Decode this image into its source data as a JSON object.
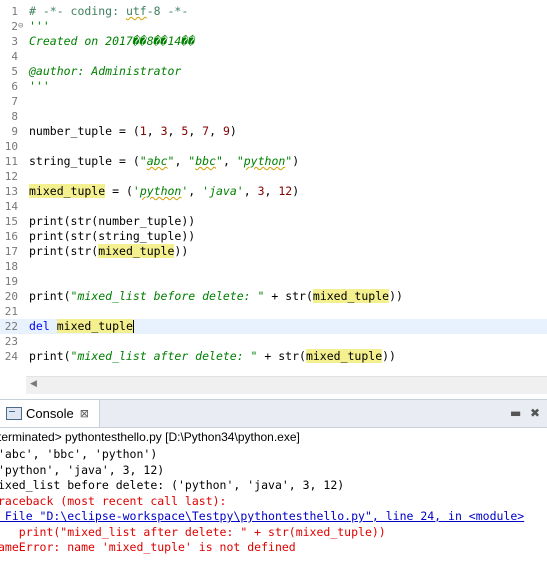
{
  "editor": {
    "current_line": 22,
    "lines": [
      {
        "n": 1,
        "fold": "",
        "html": "<span class=\"c-comment\"># -*- coding: <span class=\"sq\">utf</span>-8 -*-</span>"
      },
      {
        "n": 2,
        "fold": "⊖",
        "html": "<span class=\"c-doc\">'''</span>"
      },
      {
        "n": 3,
        "fold": "",
        "html": "<span class=\"c-doc\">Created on 2017��8��14��</span>"
      },
      {
        "n": 4,
        "fold": "",
        "html": ""
      },
      {
        "n": 5,
        "fold": "",
        "html": "<span class=\"c-doc\">@author: Administrator</span>"
      },
      {
        "n": 6,
        "fold": "",
        "html": "<span class=\"c-doc\">'''</span>"
      },
      {
        "n": 7,
        "fold": "",
        "html": ""
      },
      {
        "n": 8,
        "fold": "",
        "html": ""
      },
      {
        "n": 9,
        "fold": "",
        "html": "number_tuple = (<span class=\"c-num\">1</span>, <span class=\"c-num\">3</span>, <span class=\"c-num\">5</span>, <span class=\"c-num\">7</span>, <span class=\"c-num\">9</span>)"
      },
      {
        "n": 10,
        "fold": "",
        "html": ""
      },
      {
        "n": 11,
        "fold": "",
        "html": "string_tuple = (<span class=\"c-str\">\"<span class=\"sq\">abc</span>\"</span>, <span class=\"c-str\">\"<span class=\"sq\">bbc</span>\"</span>, <span class=\"c-str\">\"<span class=\"sq\">python</span>\"</span>)"
      },
      {
        "n": 12,
        "fold": "",
        "html": ""
      },
      {
        "n": 13,
        "fold": "",
        "html": "<span class=\"hl\">mixed_tuple</span> = (<span class=\"c-str\">'<span class=\"sq\">python</span>'</span>, <span class=\"c-str\">'java'</span>, <span class=\"c-num\">3</span>, <span class=\"c-num\">12</span>)"
      },
      {
        "n": 14,
        "fold": "",
        "html": ""
      },
      {
        "n": 15,
        "fold": "",
        "html": "print(str(number_tuple))"
      },
      {
        "n": 16,
        "fold": "",
        "html": "print(str(string_tuple))"
      },
      {
        "n": 17,
        "fold": "",
        "html": "print(str(<span class=\"hl\">mixed_tuple</span>))"
      },
      {
        "n": 18,
        "fold": "",
        "html": ""
      },
      {
        "n": 19,
        "fold": "",
        "html": ""
      },
      {
        "n": 20,
        "fold": "",
        "html": "print(<span class=\"c-str\">\"mixed_list before delete: \"</span> + str(<span class=\"hl\">mixed_tuple</span>))"
      },
      {
        "n": 21,
        "fold": "",
        "html": ""
      },
      {
        "n": 22,
        "fold": "",
        "html": "<span class=\"c-kw\">del</span> <span class=\"hl\">mixed_tuple</span><span class=\"caret\"></span>"
      },
      {
        "n": 23,
        "fold": "",
        "html": ""
      },
      {
        "n": 24,
        "fold": "",
        "html": "print(<span class=\"c-str\">\"mixed_list after delete: \"</span> + str(<span class=\"hl\">mixed_tuple</span>))"
      }
    ]
  },
  "console": {
    "tab_label": "Console",
    "close_glyph": "⊠",
    "header": "terminated> pythontesthello.py [D:\\Python34\\python.exe]",
    "output": [
      {
        "text": "'abc', 'bbc', 'python')",
        "kind": "black"
      },
      {
        "text": "'python', 'java', 3, 12)",
        "kind": "black"
      },
      {
        "text": "ixed_list before delete: ('python', 'java', 3, 12)",
        "kind": "black"
      },
      {
        "text": "raceback (most recent call last):",
        "kind": "red"
      },
      {
        "text": " File \"D:\\eclipse-workspace\\Testpy\\pythontesthello.py\", line 24, in <module>",
        "kind": "link"
      },
      {
        "text": "   print(\"mixed_list after delete: \" + str(mixed_tuple))",
        "kind": "red"
      },
      {
        "text": "ameError: name 'mixed_tuple' is not defined",
        "kind": "red"
      }
    ]
  }
}
